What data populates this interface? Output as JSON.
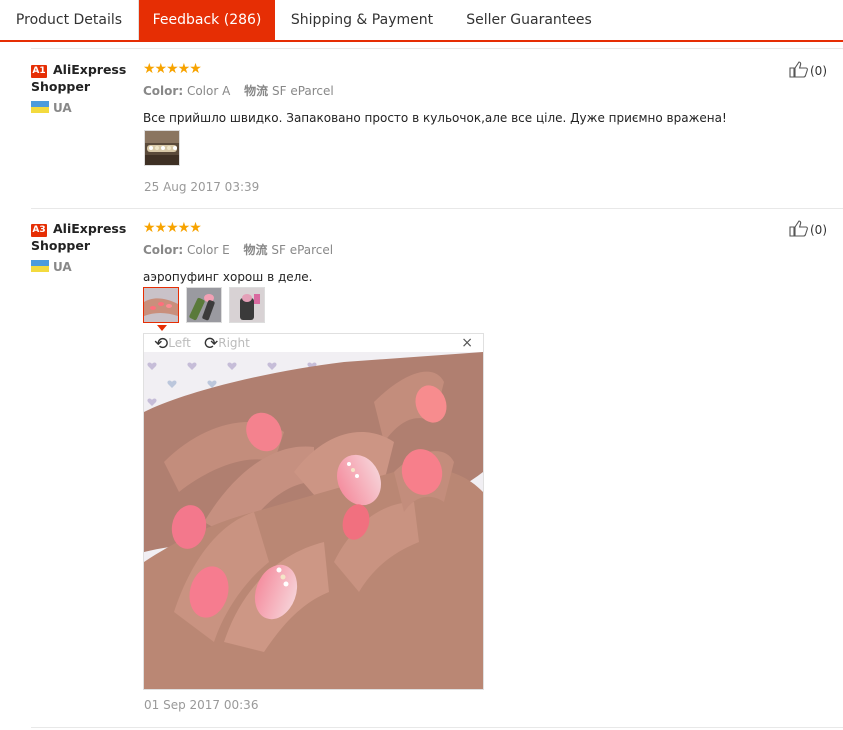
{
  "tabs": [
    {
      "label": "Product Details"
    },
    {
      "label": "Feedback (286)"
    },
    {
      "label": "Shipping & Payment"
    },
    {
      "label": "Seller Guarantees"
    }
  ],
  "reviews": [
    {
      "level": "A1",
      "name_line1": "AliExpress",
      "name_line2": "Shopper",
      "country": "UA",
      "stars": "★★★★★",
      "rating": 5,
      "color_label": "Color:",
      "color_value": "Color A",
      "ship_label": "物流",
      "ship_value": "SF eParcel",
      "text": "Все прийшло швидко. Запаковано просто в кульочок,але все ціле. Дуже приємно вражена!",
      "date": "25 Aug 2017 03:39",
      "helpful": "(0)"
    },
    {
      "level": "A3",
      "name_line1": "AliExpress",
      "name_line2": "Shopper",
      "country": "UA",
      "stars": "★★★★★",
      "rating": 5,
      "color_label": "Color:",
      "color_value": "Color E",
      "ship_label": "物流",
      "ship_value": "SF eParcel",
      "text": "аэропуфинг хорош в деле.",
      "date": "01 Sep 2017 00:36",
      "helpful": "(0)"
    }
  ],
  "viewer": {
    "rotate_left": "Left",
    "rotate_right": "Right",
    "close": "×"
  },
  "colors": {
    "accent": "#e62e04",
    "star": "#f7a300"
  }
}
